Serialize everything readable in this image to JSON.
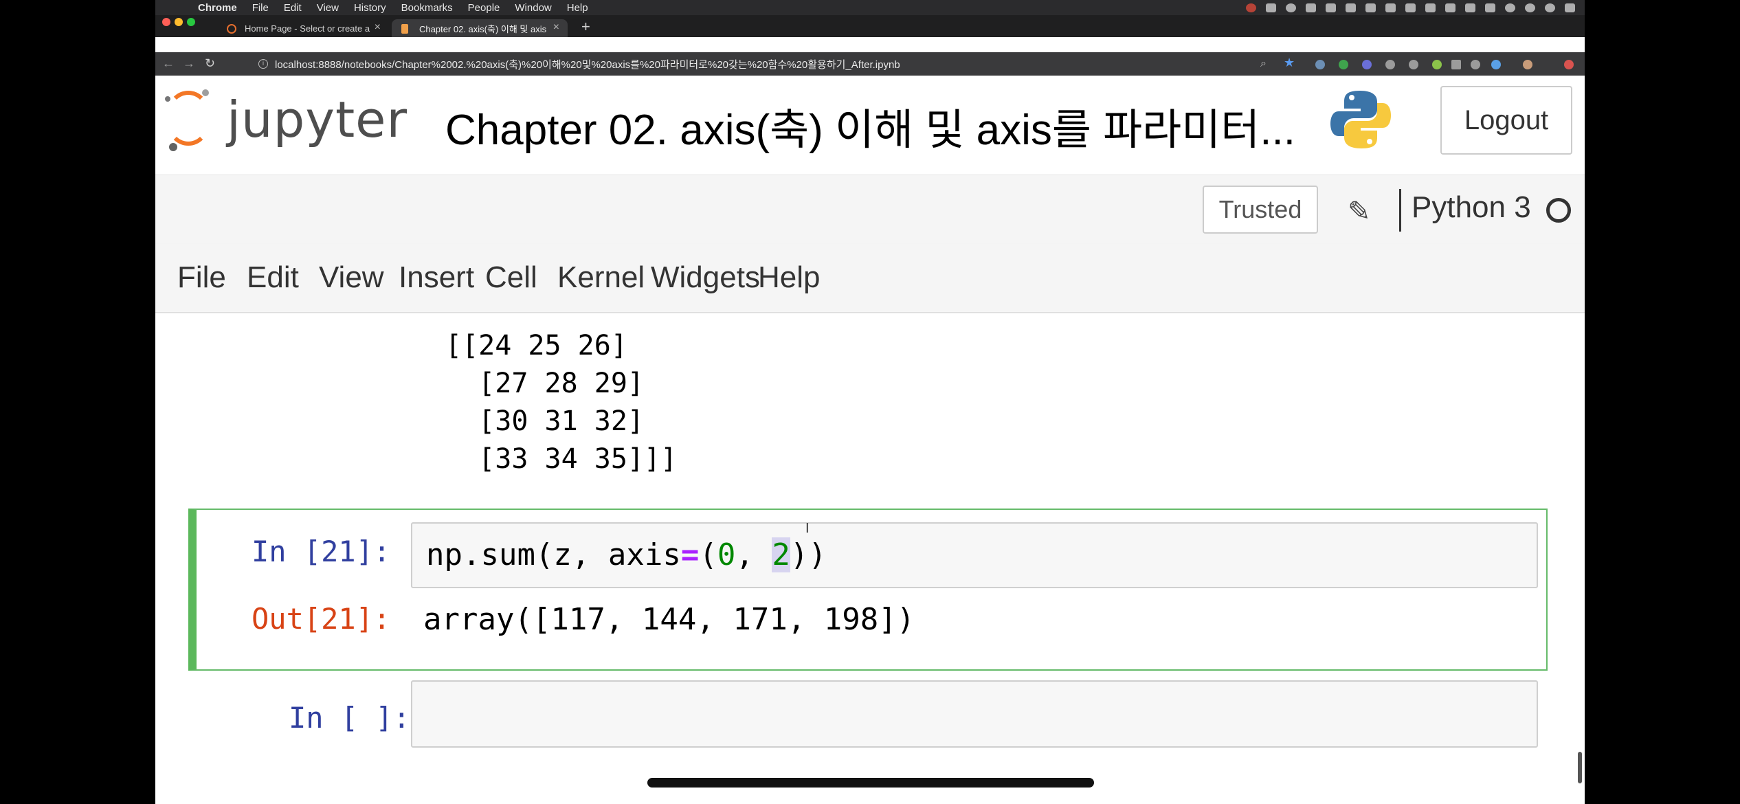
{
  "mac_menu": {
    "app": "Chrome",
    "items": [
      "File",
      "Edit",
      "View",
      "History",
      "Bookmarks",
      "People",
      "Window",
      "Help"
    ]
  },
  "tabs": [
    {
      "title": "Home Page - Select or create a",
      "active": false
    },
    {
      "title": "Chapter 02. axis(축) 이해 및 axis",
      "active": true
    }
  ],
  "address_bar": {
    "url": "localhost:8888/notebooks/Chapter%2002.%20axis(축)%20이해%20및%20axis를%20파라미터로%20갖는%20함수%20활용하기_After.ipynb"
  },
  "jupyter_header": {
    "logo_text": "jupyter",
    "notebook_title": "Chapter 02. axis(축) 이해 및 axis를 파라미터...",
    "logout_label": "Logout"
  },
  "kernel_bar": {
    "trusted_label": "Trusted",
    "kernel_name": "Python 3"
  },
  "menu": [
    "File",
    "Edit",
    "View",
    "Insert",
    "Cell",
    "Kernel",
    "Widgets",
    "Help"
  ],
  "previous_output": "[[24 25 26]\n  [27 28 29]\n  [30 31 32]\n  [33 34 35]]]",
  "cell_21": {
    "in_prompt": "In [21]:",
    "code_pre": "np.sum(z, axis",
    "code_op": "=",
    "code_paren": "(",
    "code_num1": "0",
    "code_sep": ", ",
    "code_num2": "2",
    "code_post": "))",
    "out_prompt": "Out[21]:",
    "output": "array([117, 144, 171, 198])"
  },
  "empty_cell": {
    "in_prompt": "In [ ]:"
  },
  "colors": {
    "accent_orange": "#f37726",
    "prompt_in": "#303f9f",
    "prompt_out": "#d84315",
    "selected_cell_border": "#66bb6a"
  }
}
